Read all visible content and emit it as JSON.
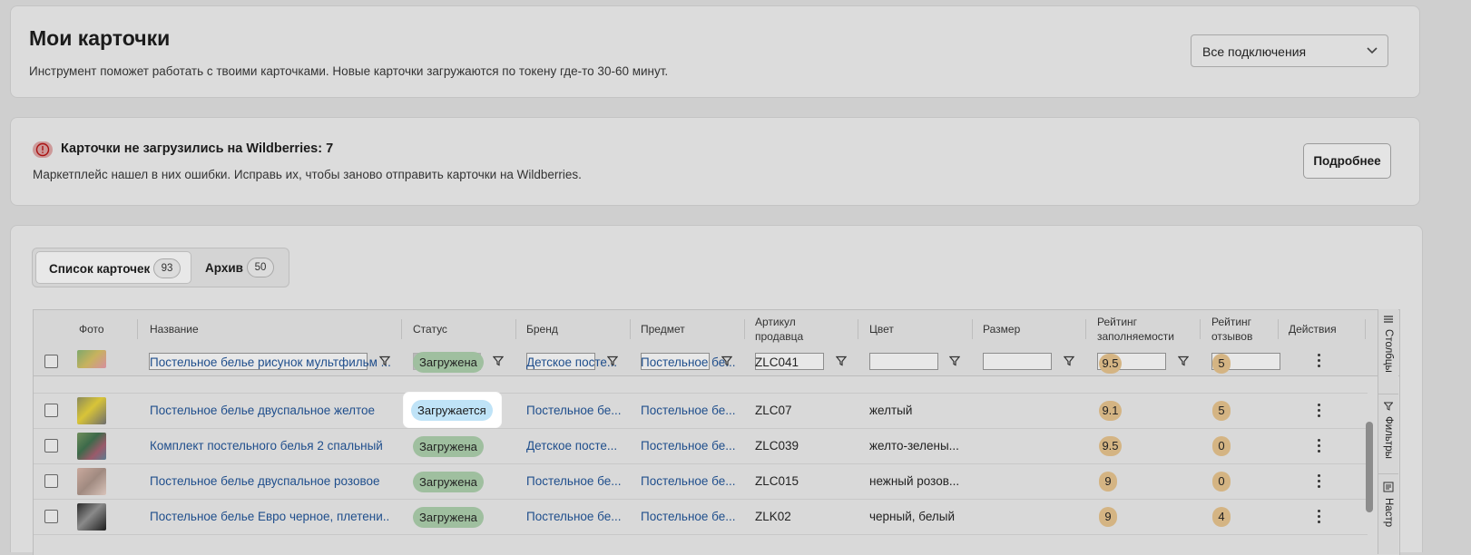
{
  "header": {
    "title": "Мои карточки",
    "description": "Инструмент поможет работать с твоими карточками. Новые карточки загружаются по токену где-то 30-60 минут.",
    "connections_select": "Все подключения"
  },
  "alert": {
    "title": "Карточки не загрузились на Wildberries: 7",
    "text": "Маркетплейс нашел в них ошибки. Исправь их, чтобы заново отправить карточки на Wildberries.",
    "button": "Подробнее"
  },
  "tabs": [
    {
      "label": "Список карточек",
      "count": "93"
    },
    {
      "label": "Архив",
      "count": "50"
    }
  ],
  "columns": {
    "photo": "Фото",
    "name": "Название",
    "status": "Статус",
    "brand": "Бренд",
    "subject": "Предмет",
    "article": "Артикул продавца",
    "color": "Цвет",
    "size": "Размер",
    "fill_rating": "Рейтинг заполняемости",
    "review_rating": "Рейтинг отзывов",
    "actions": "Действия"
  },
  "side_panel": {
    "columns": "Столбцы",
    "filters": "Фильтры",
    "settings": "Настр"
  },
  "rows": [
    {
      "name": "Постельное белье рисунок мультфильм ...",
      "status": "Загружена",
      "brand": "Детское посте...",
      "subject": "Постельное бе...",
      "article": "ZLC041",
      "color": "",
      "fill": "9.5",
      "reviews": "5"
    },
    {
      "name": "Постельное белье двуспальное желтое",
      "status": "Загружается",
      "brand": "Постельное бе...",
      "subject": "Постельное бе...",
      "article": "ZLC07",
      "color": "желтый",
      "fill": "9.1",
      "reviews": "5"
    },
    {
      "name": "Комплект постельного белья 2 спальный",
      "status": "Загружена",
      "brand": "Детское посте...",
      "subject": "Постельное бе...",
      "article": "ZLC039",
      "color": "желто-зелены...",
      "fill": "9.5",
      "reviews": "0"
    },
    {
      "name": "Постельное белье двуспальное розовое",
      "status": "Загружена",
      "brand": "Постельное бе...",
      "subject": "Постельное бе...",
      "article": "ZLC015",
      "color": "нежный розов...",
      "fill": "9",
      "reviews": "0"
    },
    {
      "name": "Постельное белье Евро черное, плетени...",
      "status": "Загружена",
      "brand": "Постельное бе...",
      "subject": "Постельное бе...",
      "article": "ZLK02",
      "color": "черный, белый",
      "fill": "9",
      "reviews": "4"
    }
  ],
  "highlight_status": "Загружается",
  "colors": {
    "link": "#1f4e8c",
    "loaded": "#9fbf9f",
    "loading": "#bfe3f7",
    "rating": "#d4b483"
  }
}
